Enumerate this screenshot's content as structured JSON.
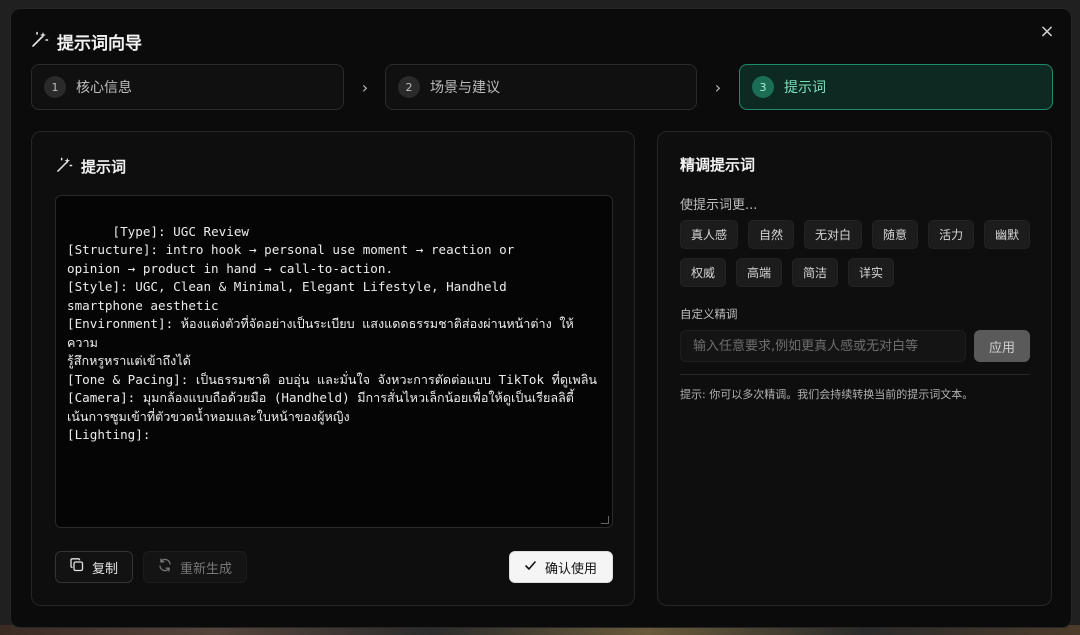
{
  "modal": {
    "title": "提示词向导",
    "close_label": "×"
  },
  "steps": [
    {
      "number": "1",
      "label": "核心信息"
    },
    {
      "number": "2",
      "label": "场景与建议"
    },
    {
      "number": "3",
      "label": "提示词"
    }
  ],
  "left_panel": {
    "title": "提示词",
    "prompt_text": "[Type]: UGC Review\n[Structure]: intro hook → personal use moment → reaction or\nopinion → product in hand → call-to-action.\n[Style]: UGC, Clean & Minimal, Elegant Lifestyle, Handheld\nsmartphone aesthetic\n[Environment]: ห้องแต่งตัวที่จัดอย่างเป็นระเบียบ แสงแดดธรรมชาติส่องผ่านหน้าต่าง ให้ความ\nรู้สึกหรูหราแต่เข้าถึงได้\n[Tone & Pacing]: เป็นธรรมชาติ อบอุ่น และมั่นใจ จังหวะการตัดต่อแบบ TikTok ที่ดูเพลิน\n[Camera]: มุมกล้องแบบถือด้วยมือ (Handheld) มีการสั่นไหวเล็กน้อยเพื่อให้ดูเป็นเรียลลิตี้\nเน้นการซูมเข้าที่ตัวขวดน้ำหอมและใบหน้าของผู้หญิง\n[Lighting]:",
    "copy_label": "复制",
    "regen_label": "重新生成",
    "confirm_label": "确认使用"
  },
  "right_panel": {
    "title": "精调提示词",
    "subtitle": "使提示词更...",
    "chips": [
      "真人感",
      "自然",
      "无对白",
      "随意",
      "活力",
      "幽默",
      "权威",
      "高端",
      "简洁",
      "详实"
    ],
    "custom_label": "自定义精调",
    "custom_placeholder": "输入任意要求,例如更真人感或无对白等",
    "apply_label": "应用",
    "hint": "提示: 你可以多次精调。我们会持续转换当前的提示词文本。"
  },
  "colors": {
    "accent": "#1f8a6a",
    "accent_text": "#7ee2bf",
    "background": "#0b0b0b"
  }
}
